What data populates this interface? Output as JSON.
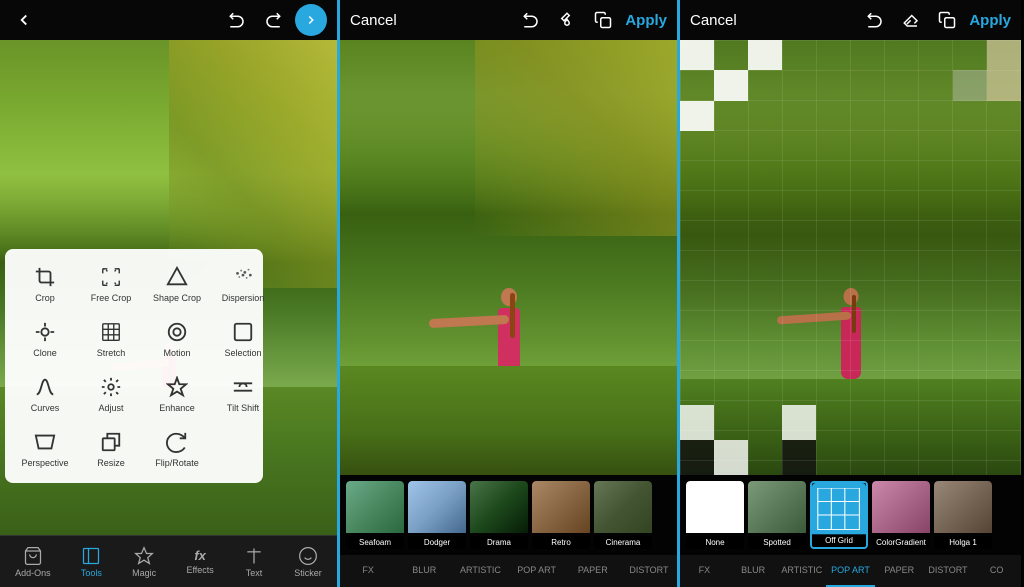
{
  "panels": {
    "left": {
      "topBar": {
        "backIcon": "←",
        "undoIcon": "↩",
        "redoIcon": "↪",
        "nextArrow": "→"
      },
      "toolMenu": {
        "items": [
          {
            "id": "crop",
            "label": "Crop",
            "icon": "⬜"
          },
          {
            "id": "free-crop",
            "label": "Free Crop",
            "icon": "⟲"
          },
          {
            "id": "shape-crop",
            "label": "Shape Crop",
            "icon": "△"
          },
          {
            "id": "dispersion",
            "label": "Dispersion",
            "icon": "✦"
          },
          {
            "id": "clone",
            "label": "Clone",
            "icon": "⊕"
          },
          {
            "id": "stretch",
            "label": "Stretch",
            "icon": "⊞"
          },
          {
            "id": "motion",
            "label": "Motion",
            "icon": "⌀"
          },
          {
            "id": "selection",
            "label": "Selection",
            "icon": "▭"
          },
          {
            "id": "curves",
            "label": "Curves",
            "icon": "⌇"
          },
          {
            "id": "adjust",
            "label": "Adjust",
            "icon": "✦"
          },
          {
            "id": "enhance",
            "label": "Enhance",
            "icon": "✳"
          },
          {
            "id": "tilt-shift",
            "label": "Tilt Shift",
            "icon": "◎"
          },
          {
            "id": "perspective",
            "label": "Perspective",
            "icon": "⬡"
          },
          {
            "id": "resize",
            "label": "Resize",
            "icon": "⬜"
          },
          {
            "id": "flip-rotate",
            "label": "Flip/Rotate",
            "icon": "↻"
          }
        ]
      },
      "bottomBar": {
        "items": [
          {
            "id": "add-ons",
            "label": "Add-Ons",
            "active": false,
            "icon": "🛍"
          },
          {
            "id": "tools",
            "label": "Tools",
            "active": true,
            "icon": "⬜"
          },
          {
            "id": "magic",
            "label": "Magic",
            "active": false,
            "icon": "✦"
          },
          {
            "id": "effects",
            "label": "Effects",
            "active": false,
            "icon": "fx"
          },
          {
            "id": "text",
            "label": "Text",
            "active": false,
            "icon": "T"
          },
          {
            "id": "sticker",
            "label": "Sticker",
            "active": false,
            "icon": "😊"
          }
        ]
      }
    },
    "center": {
      "topBar": {
        "cancelText": "Cancel",
        "undoIcon": "↩",
        "brushIcon": "✏",
        "copyIcon": "⧉",
        "applyText": "Apply"
      },
      "filterStrip": {
        "filters": [
          {
            "id": "seafoam",
            "label": "Seafoam"
          },
          {
            "id": "dodger",
            "label": "Dodger"
          },
          {
            "id": "drama",
            "label": "Drama"
          },
          {
            "id": "retro",
            "label": "Retro"
          },
          {
            "id": "cinerama",
            "label": "Cinerama"
          }
        ]
      },
      "tabBar": {
        "tabs": [
          {
            "id": "fx",
            "label": "FX",
            "active": false
          },
          {
            "id": "blur",
            "label": "BLUR",
            "active": false
          },
          {
            "id": "artistic",
            "label": "ARTISTIC",
            "active": false
          },
          {
            "id": "pop-art",
            "label": "POP ART",
            "active": false
          },
          {
            "id": "paper",
            "label": "PAPER",
            "active": false
          },
          {
            "id": "distort",
            "label": "DISTORT",
            "active": false
          }
        ]
      }
    },
    "right": {
      "topBar": {
        "cancelText": "Cancel",
        "undoIcon": "↩",
        "eraseIcon": "⬜",
        "copyIcon": "⧉",
        "applyText": "Apply"
      },
      "filterStrip": {
        "filters": [
          {
            "id": "none",
            "label": "None"
          },
          {
            "id": "spotted",
            "label": "Spotted"
          },
          {
            "id": "off-grid",
            "label": "Off Grid",
            "active": true
          },
          {
            "id": "color-gradient",
            "label": "ColorGradient"
          },
          {
            "id": "holga-1",
            "label": "Holga 1"
          }
        ]
      },
      "tabBar": {
        "tabs": [
          {
            "id": "fx",
            "label": "FX",
            "active": false
          },
          {
            "id": "blur",
            "label": "BLUR",
            "active": false
          },
          {
            "id": "artistic",
            "label": "ARTISTIC",
            "active": false
          },
          {
            "id": "pop-art",
            "label": "POP ART",
            "active": true
          },
          {
            "id": "paper",
            "label": "PAPER",
            "active": false
          },
          {
            "id": "distort",
            "label": "DISTORT",
            "active": false
          },
          {
            "id": "co",
            "label": "CO",
            "active": false
          }
        ]
      }
    }
  }
}
